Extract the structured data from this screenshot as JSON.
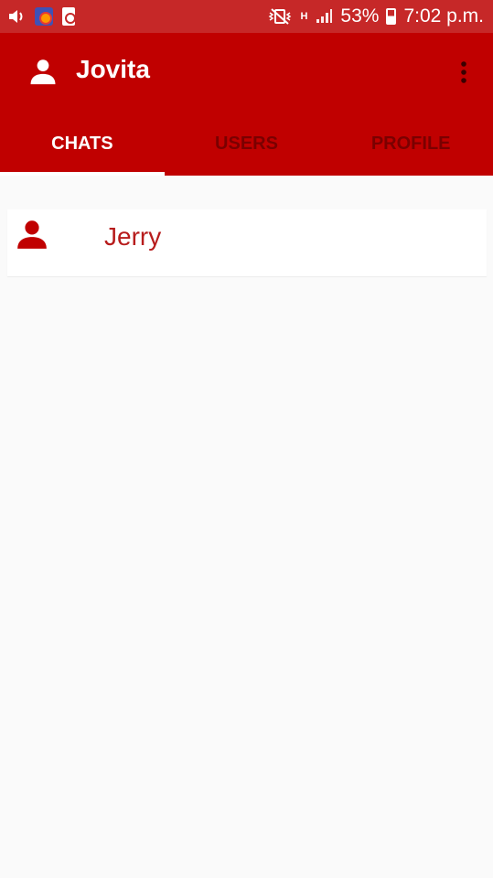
{
  "status_bar": {
    "battery": "53%",
    "time": "7:02 p.m.",
    "network_type": "H"
  },
  "app_bar": {
    "title": "Jovita",
    "icons": {
      "account": "account-icon",
      "overflow": "more-vert-icon"
    }
  },
  "tabs": [
    {
      "label": "CHATS",
      "active": true
    },
    {
      "label": "USERS",
      "active": false
    },
    {
      "label": "PROFILE",
      "active": false
    }
  ],
  "chats": [
    {
      "name": "Jerry",
      "icon": "person-icon"
    }
  ],
  "colors": {
    "primary": "#c00000",
    "status_bar": "#c62828",
    "accent_text": "#b71c1c",
    "inactive_tab": "#7a0000",
    "background": "#fafafa"
  }
}
